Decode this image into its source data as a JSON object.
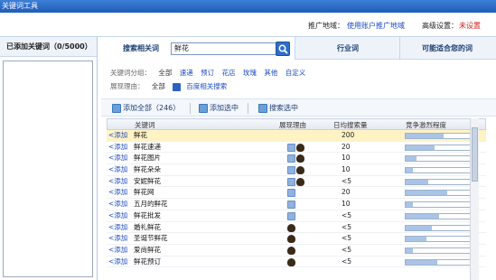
{
  "window": {
    "title": "关键词工具"
  },
  "topbar": {
    "promo_label": "推广地域：",
    "promo_value": "使用账户推广地域",
    "adv_label": "高级设置：",
    "adv_value": "未设置"
  },
  "left": {
    "header": "已添加关键词（0/5000）"
  },
  "tabs": {
    "search_label": "搜索相关词",
    "search_value": "鲜花",
    "industry": "行业词",
    "suggest": "可能适合您的词"
  },
  "filters": {
    "group_label": "关键词分组：",
    "group_opts": [
      "全部",
      "速递",
      "预订",
      "花店",
      "玫瑰",
      "其他",
      "自定义"
    ],
    "reason_label": "展现理由：",
    "reason_opts": [
      "全部",
      "百度相关搜索"
    ]
  },
  "toolbar": {
    "add_all": "添加全部（246）",
    "add_selected": "添加选中",
    "search_selected": "搜索选中"
  },
  "grid": {
    "headers": [
      "关键词",
      "展现理由",
      "日均搜索量",
      "竞争激烈程度"
    ],
    "rows": [
      {
        "add": "<添加",
        "kw": "鲜花",
        "vol": "200",
        "icons": [],
        "comp": 0.55,
        "sel": true
      },
      {
        "add": "<添加",
        "kw": "鲜花速递",
        "vol": "20",
        "icons": [
          "blue",
          "bear"
        ],
        "comp": 0.42
      },
      {
        "add": "<添加",
        "kw": "鲜花图片",
        "vol": "10",
        "icons": [
          "blue",
          "bear"
        ],
        "comp": 0.15
      },
      {
        "add": "<添加",
        "kw": "鲜花朵朵",
        "vol": "10",
        "icons": [
          "blue",
          "bear"
        ],
        "comp": 0.1
      },
      {
        "add": "<添加",
        "kw": "安妮鲜花",
        "vol": "<5",
        "icons": [
          "blue",
          "bear"
        ],
        "comp": 0.32
      },
      {
        "add": "<添加",
        "kw": "鲜花网",
        "vol": "20",
        "icons": [
          "blue"
        ],
        "comp": 0.6
      },
      {
        "add": "<添加",
        "kw": "五月的鲜花",
        "vol": "10",
        "icons": [
          "blue"
        ],
        "comp": 0.1
      },
      {
        "add": "<添加",
        "kw": "鲜花批发",
        "vol": "<5",
        "icons": [
          "blue"
        ],
        "comp": 0.48
      },
      {
        "add": "<添加",
        "kw": "婚礼鲜花",
        "vol": "<5",
        "icons": [
          "bear"
        ],
        "comp": 0.38
      },
      {
        "add": "<添加",
        "kw": "圣诞节鲜花",
        "vol": "<5",
        "icons": [
          "bear"
        ],
        "comp": 0.3
      },
      {
        "add": "<添加",
        "kw": "爱尚鲜花",
        "vol": "<5",
        "icons": [
          "bear"
        ],
        "comp": 0.1
      },
      {
        "add": "<添加",
        "kw": "鲜花预订",
        "vol": "<5",
        "icons": [
          "bear"
        ],
        "comp": 0.45
      }
    ]
  },
  "colors": {
    "accent": "#1f5db8",
    "link": "#1a49c2",
    "selected_row": "#fff3c4"
  }
}
